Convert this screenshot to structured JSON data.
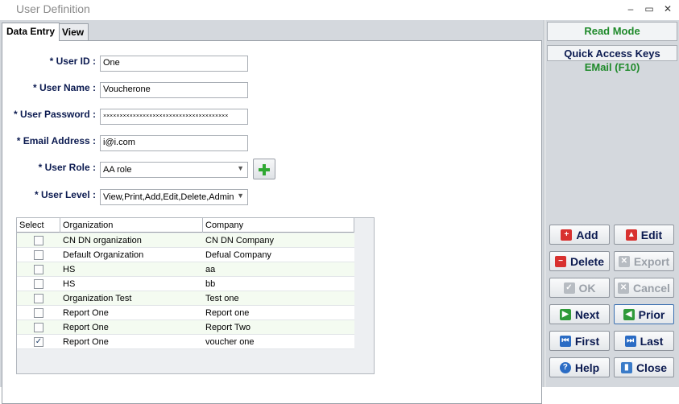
{
  "window": {
    "title": "User Definition",
    "controls": {
      "minimize": "–",
      "maximize": "▭",
      "close": "✕"
    }
  },
  "tabs": [
    {
      "label": "Data Entry"
    },
    {
      "label": "View"
    }
  ],
  "form": {
    "user_id": {
      "label": "* User ID :",
      "value": "One"
    },
    "user_name": {
      "label": "* User Name :",
      "value": "Voucherone"
    },
    "user_password": {
      "label": "* User Password :",
      "value": "××××××××××××××××××××××××××××××××××××××"
    },
    "email": {
      "label": "* Email Address :",
      "value": "i@i.com"
    },
    "user_role": {
      "label": "* User Role :",
      "value": "AA role"
    },
    "user_level": {
      "label": "* User Level :",
      "value": "View,Print,Add,Edit,Delete,Admin"
    }
  },
  "grid": {
    "headers": [
      "Select",
      "Organization",
      "Company"
    ],
    "rows": [
      {
        "checked": false,
        "organization": "CN DN organization",
        "company": "CN DN Company"
      },
      {
        "checked": false,
        "organization": "Default Organization",
        "company": "Defual Company"
      },
      {
        "checked": false,
        "organization": "HS",
        "company": "aa"
      },
      {
        "checked": false,
        "organization": "HS",
        "company": "bb"
      },
      {
        "checked": false,
        "organization": "Organization Test",
        "company": "Test one"
      },
      {
        "checked": false,
        "organization": "Report One",
        "company": "Report one"
      },
      {
        "checked": false,
        "organization": "Report One",
        "company": "Report Two"
      },
      {
        "checked": true,
        "organization": "Report One",
        "company": "voucher one"
      }
    ]
  },
  "side": {
    "mode": "Read Mode",
    "quick_access_title": "Quick Access Keys",
    "quick_access_item": "EMail (F10)"
  },
  "buttons": {
    "add": "Add",
    "edit": "Edit",
    "delete": "Delete",
    "export": "Export",
    "ok": "OK",
    "cancel": "Cancel",
    "next": "Next",
    "prior": "Prior",
    "first": "First",
    "last": "Last",
    "help": "Help",
    "close": "Close"
  },
  "colors": {
    "green_accent": "#1f8a2b",
    "navy_text": "#0b1a50",
    "panel_bg": "#d4d8dd"
  }
}
